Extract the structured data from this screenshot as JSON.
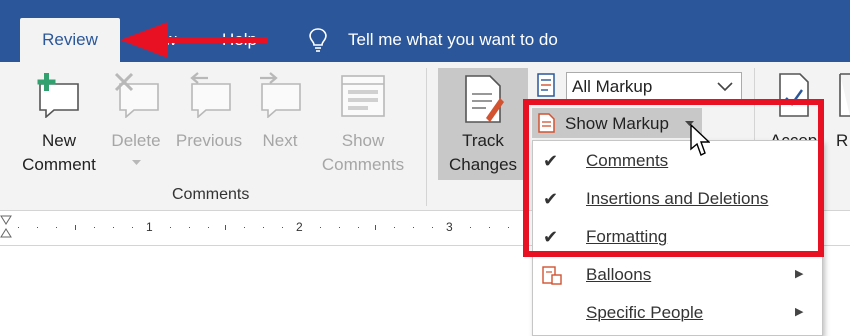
{
  "tabs": {
    "review": "Review",
    "view": "View",
    "help": "Help",
    "tell_me": "Tell me what you want to do"
  },
  "ribbon": {
    "new_comment": [
      "New",
      "Comment"
    ],
    "delete": [
      "Delete"
    ],
    "previous": "Previous",
    "next": "Next",
    "show_comments": [
      "Show",
      "Comments"
    ],
    "comments_group": "Comments",
    "track_changes": [
      "Track",
      "Changes"
    ],
    "markup_select": "All Markup",
    "show_markup": "Show Markup",
    "accept_partial": "Accep",
    "reject_partial": "R"
  },
  "ruler": {
    "marks": [
      "1",
      "2",
      "3"
    ]
  },
  "menu": {
    "items": [
      {
        "label": "Comments",
        "checked": true,
        "submenu": false
      },
      {
        "label": "Insertions and Deletions",
        "checked": true,
        "submenu": false
      },
      {
        "label": "Formatting",
        "checked": true,
        "submenu": false
      },
      {
        "label": "Balloons",
        "checked": false,
        "submenu": true
      },
      {
        "label": "Specific People",
        "checked": false,
        "submenu": true
      }
    ]
  },
  "colors": {
    "accent": "#2b579a",
    "highlight": "#e81123",
    "ribbon_bg": "#f3f3f3"
  },
  "icons": [
    "new-comment-icon",
    "delete-comment-icon",
    "previous-comment-icon",
    "next-comment-icon",
    "show-comments-icon",
    "track-changes-icon",
    "markup-icon",
    "lightbulb-icon",
    "check-icon",
    "submenu-arrow-icon",
    "mouse-cursor-icon",
    "red-arrow-annotation"
  ]
}
